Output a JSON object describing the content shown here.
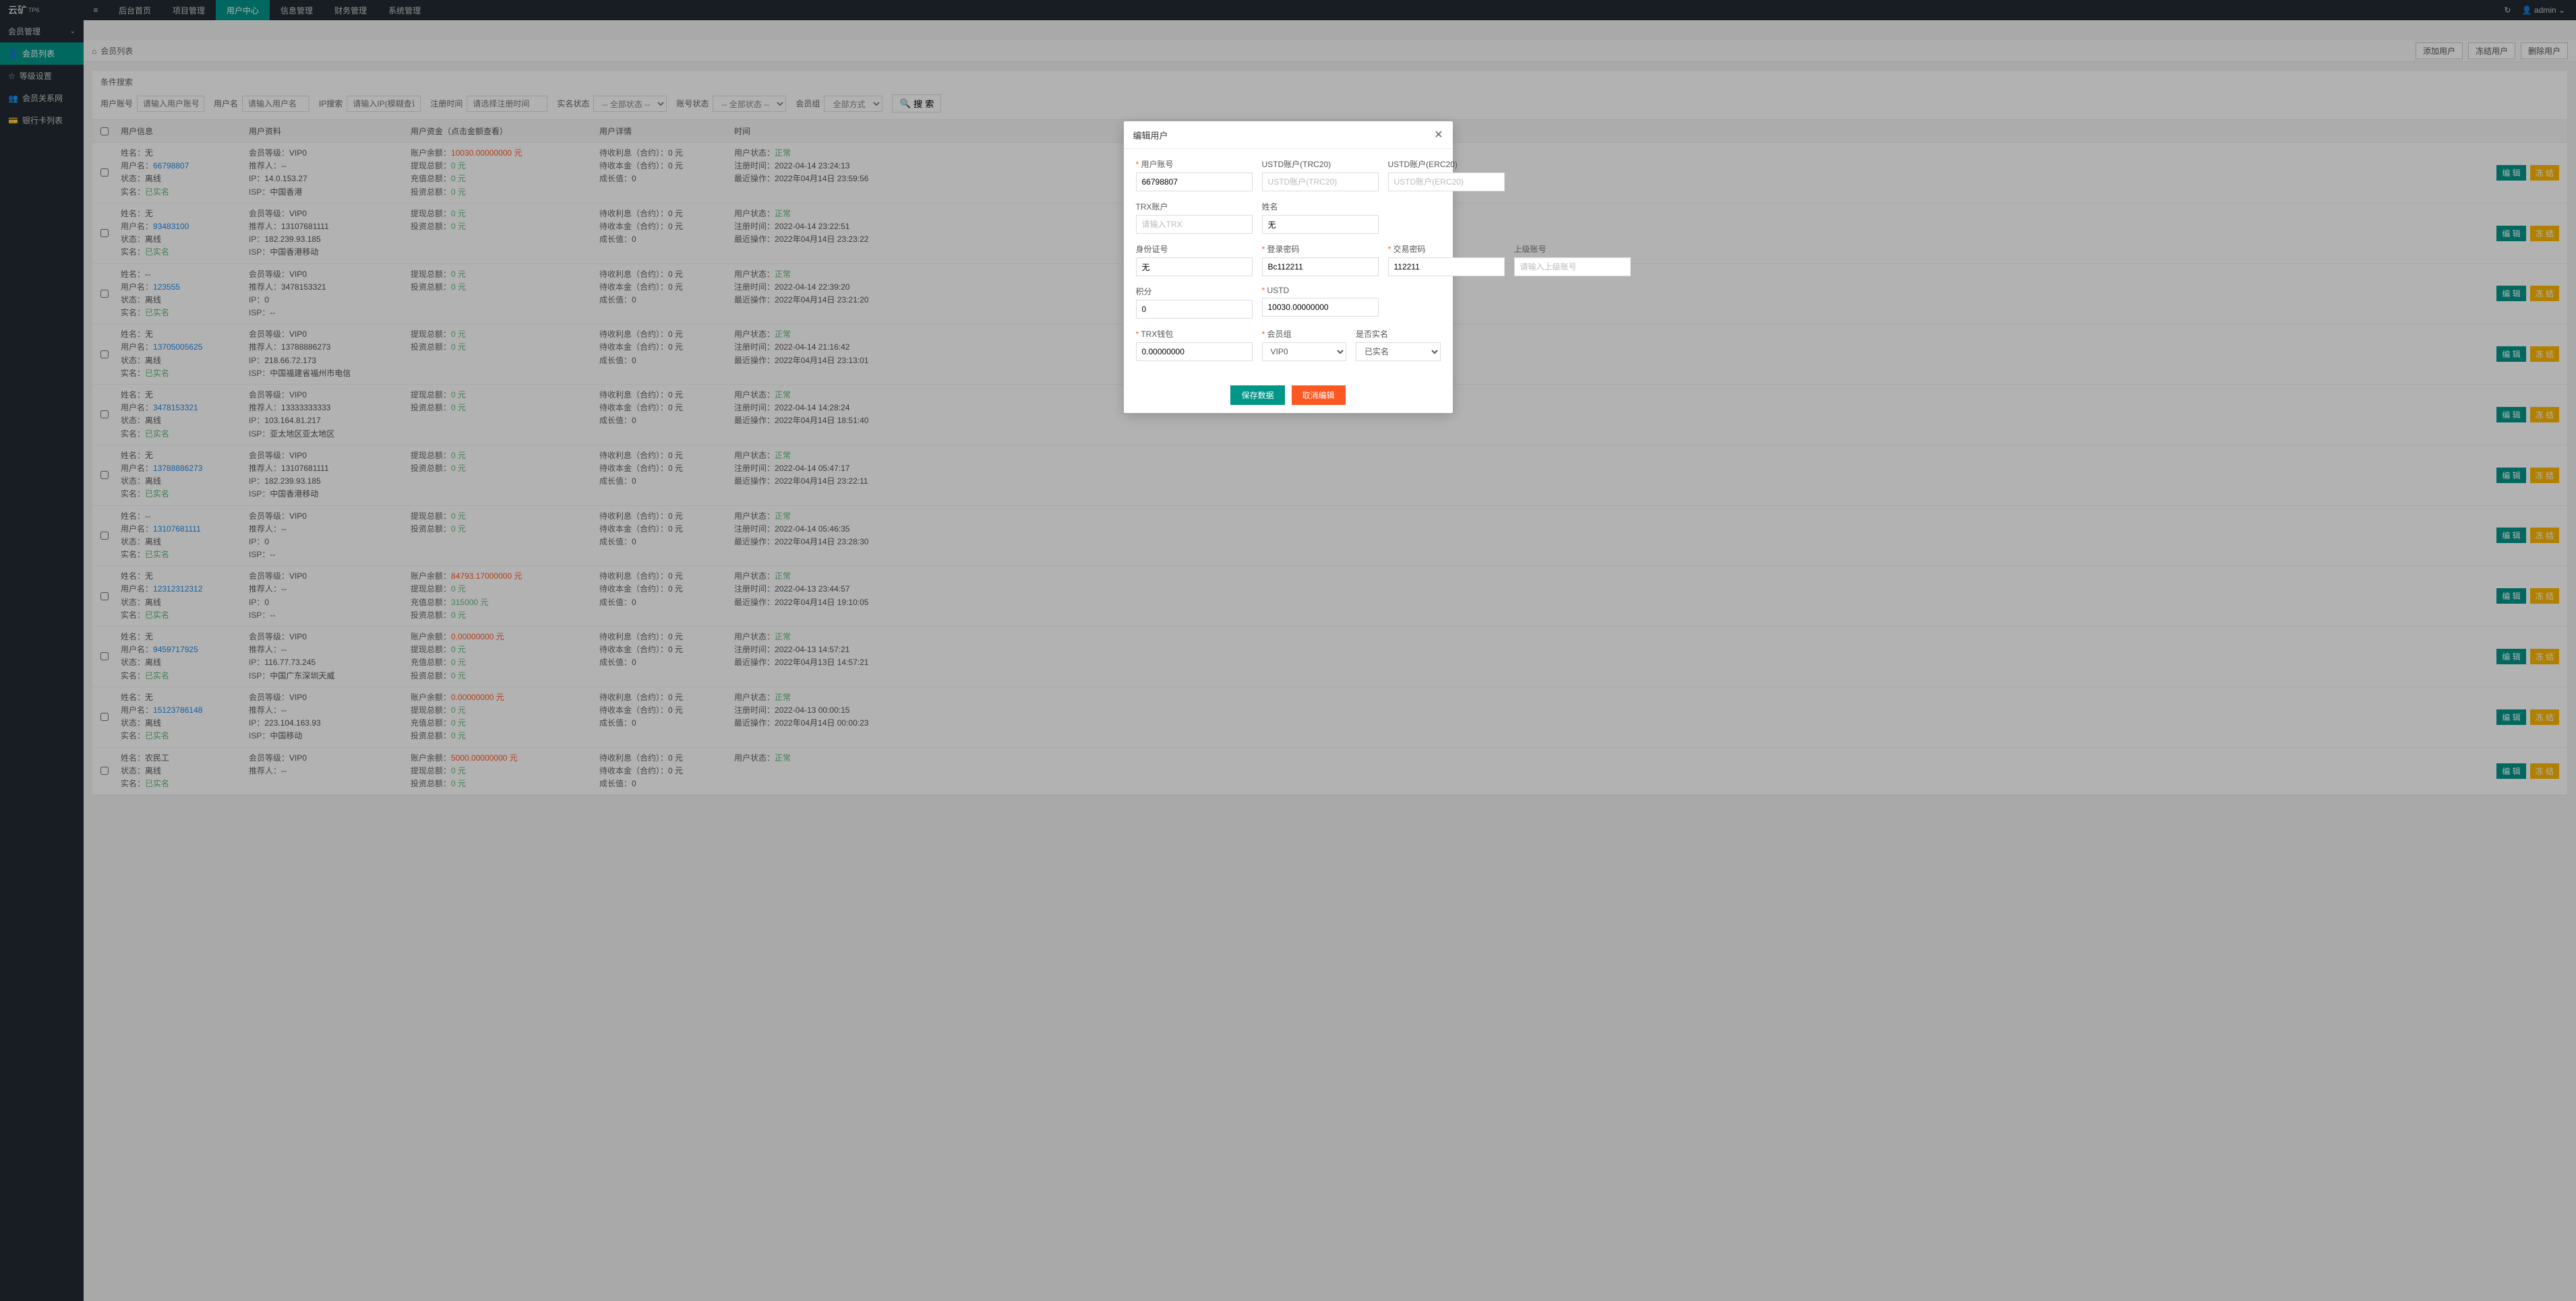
{
  "brand": {
    "name": "云矿",
    "sup": "TP6"
  },
  "topnav": [
    "后台首页",
    "项目管理",
    "用户中心",
    "信息管理",
    "财务管理",
    "系统管理"
  ],
  "topnav_active": 2,
  "topright": {
    "refresh": "↻",
    "user": "admin"
  },
  "sidebar": {
    "group": "会员管理",
    "items": [
      {
        "icon": "👤",
        "label": "会员列表",
        "active": true
      },
      {
        "icon": "☆",
        "label": "等级设置"
      },
      {
        "icon": "👥",
        "label": "会员关系网"
      },
      {
        "icon": "💳",
        "label": "银行卡列表"
      }
    ]
  },
  "crumb": {
    "icon": "⌂",
    "text": "会员列表"
  },
  "header_buttons": [
    "添加用户",
    "冻结用户",
    "删除用户"
  ],
  "search": {
    "title": "条件搜索",
    "fields": {
      "account_label": "用户账号",
      "account_ph": "请输入用户账号",
      "username_label": "用户名",
      "username_ph": "请输入用户名",
      "ip_label": "IP搜索",
      "ip_ph": "请输入IP(模糊查询)",
      "regtime_label": "注册时间",
      "regtime_ph": "请选择注册时间",
      "realname_label": "实名状态",
      "realname_sel": "-- 全部状态 --",
      "acctstatus_label": "账号状态",
      "acctstatus_sel": "-- 全部状态 --",
      "group_label": "会员组",
      "group_sel": "全部方式"
    },
    "search_btn": "搜 索"
  },
  "table": {
    "headers": [
      "用户信息",
      "用户资料",
      "用户资金（点击金额查看）",
      "用户详情",
      "时间"
    ],
    "actions": {
      "edit": "编 辑",
      "freeze": "冻 结"
    },
    "labels": {
      "name": "姓名：",
      "account": "用户名：",
      "status": "状态：",
      "realname": "实名：",
      "level": "会员等级：",
      "referrer": "推荐人：",
      "ip": "IP：",
      "isp": "ISP：",
      "balance": "账户余额：",
      "withdraw": "提现总额：",
      "recharge": "充值总额：",
      "invest": "投资总额：",
      "pending_interest": "待收利息（合约）：",
      "pending_principal": "待收本金（合约）：",
      "growth": "成长值：",
      "user_status": "用户状态：",
      "reg_time": "注册时间：",
      "last_op": "最近操作："
    },
    "zero_yuan": "0 元",
    "status_offline": "离线",
    "status_normal": "正常",
    "realname_done": "已实名",
    "rows": [
      {
        "name": "无",
        "account": "66798807",
        "ip": "14.0.153.27",
        "isp": "中国香港",
        "referrer": "--",
        "balance": "10030.00000000 元",
        "recharge": "0 元",
        "reg": "2022-04-14 23:24:13",
        "last": "2022年04月14日 23:59:56"
      },
      {
        "name": "无",
        "account": "93483100",
        "ip": "182.239.93.185",
        "isp": "中国香港移动",
        "referrer": "13107681111",
        "reg": "2022-04-14 23:22:51",
        "last": "2022年04月14日 23:23:22"
      },
      {
        "name": "--",
        "account": "123555",
        "ip": "0",
        "isp": "--",
        "referrer": "3478153321",
        "reg": "2022-04-14 22:39:20",
        "last": "2022年04月14日 23:21:20"
      },
      {
        "name": "无",
        "account": "13705005625",
        "ip": "218.66.72.173",
        "isp": "中国福建省福州市电信",
        "referrer": "13788886273",
        "reg": "2022-04-14 21:16:42",
        "last": "2022年04月14日 23:13:01"
      },
      {
        "name": "无",
        "account": "3478153321",
        "ip": "103.164.81.217",
        "isp": "亚太地区亚太地区",
        "referrer": "13333333333",
        "reg": "2022-04-14 14:28:24",
        "last": "2022年04月14日 18:51:40"
      },
      {
        "name": "无",
        "account": "13788886273",
        "ip": "182.239.93.185",
        "isp": "中国香港移动",
        "referrer": "13107681111",
        "reg": "2022-04-14 05:47:17",
        "last": "2022年04月14日 23:22:11"
      },
      {
        "name": "--",
        "account": "13107681111",
        "ip": "0",
        "isp": "--",
        "referrer": "--",
        "reg": "2022-04-14 05:46:35",
        "last": "2022年04月14日 23:28:30"
      },
      {
        "name": "无",
        "account": "12312312312",
        "ip": "0",
        "isp": "--",
        "referrer": "--",
        "balance": "84793.17000000 元",
        "recharge": "315000 元",
        "reg": "2022-04-13 23:44:57",
        "last": "2022年04月14日 19:10:05"
      },
      {
        "name": "无",
        "account": "9459717925",
        "ip": "116.77.73.245",
        "isp": "中国广东深圳天威",
        "referrer": "--",
        "balance": "0.00000000 元",
        "recharge": "0 元",
        "reg": "2022-04-13 14:57:21",
        "last": "2022年04月13日 14:57:21"
      },
      {
        "name": "无",
        "account": "15123786148",
        "ip": "223.104.163.93",
        "isp": "中国移动",
        "referrer": "--",
        "balance": "0.00000000 元",
        "recharge": "0 元",
        "reg": "2022-04-13 00:00:15",
        "last": "2022年04月14日 00:00:23"
      },
      {
        "name": "农民工",
        "account": "",
        "ip": "",
        "isp": "",
        "referrer": "--",
        "balance": "5000.00000000 元",
        "recharge": "",
        "reg": "",
        "last": ""
      }
    ]
  },
  "modal": {
    "title": "编辑用户",
    "labels": {
      "account": "用户账号",
      "usdt_trc20": "USTD账户(TRC20)",
      "usdt_erc20": "USTD账户(ERC20)",
      "trx": "TRX账户",
      "name": "姓名",
      "idcard": "身份证号",
      "login_pwd": "登录密码",
      "trade_pwd": "交易密码",
      "parent": "上级账号",
      "points": "积分",
      "ustd": "USTD",
      "trx_wallet": "TRX钱包",
      "group": "会员组",
      "realname": "是否实名"
    },
    "placeholders": {
      "usdt_trc20": "USTD账户(TRC20)",
      "usdt_erc20": "USTD账户(ERC20)",
      "trx": "请输入TRX",
      "parent": "请输入上级账号"
    },
    "values": {
      "account": "66798807",
      "name": "无",
      "idcard": "无",
      "login_pwd": "Bc112211",
      "trade_pwd": "112211",
      "points": "0",
      "ustd": "10030.00000000",
      "trx_wallet": "0.00000000",
      "group": "VIP0",
      "realname": "已实名"
    },
    "buttons": {
      "save": "保存数据",
      "cancel": "取消编辑"
    }
  }
}
